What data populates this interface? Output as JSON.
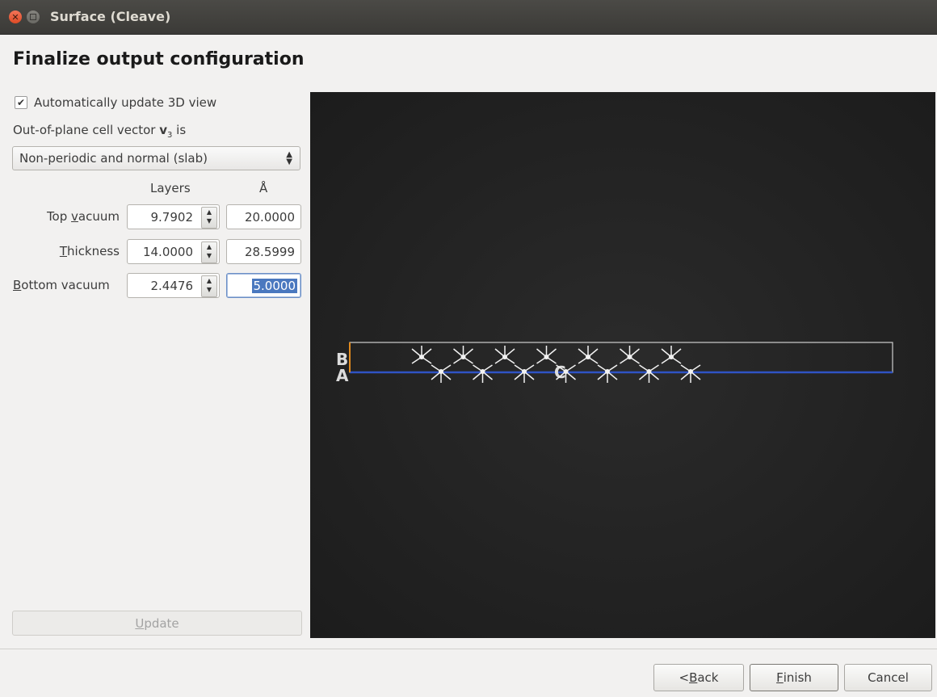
{
  "window": {
    "title": "Surface (Cleave)"
  },
  "page": {
    "title": "Finalize output configuration"
  },
  "auto_update": {
    "label": "Automatically update 3D view",
    "checked": true
  },
  "vector_label": {
    "prefix": "Out-of-plane cell vector ",
    "bold": "v",
    "sub": "3",
    "suffix": " is"
  },
  "vector_combo": {
    "value": "Non-periodic and normal (slab)"
  },
  "columns": {
    "layers": "Layers",
    "angstrom": "Å"
  },
  "rows": [
    {
      "pre": "Top ",
      "mn": "v",
      "post": "acuum",
      "layers": "9.7902",
      "angstrom": "20.0000"
    },
    {
      "pre": "",
      "mn": "T",
      "post": "hickness",
      "layers": "14.0000",
      "angstrom": "28.5999"
    },
    {
      "pre": "",
      "mn": "B",
      "post": "ottom vacuum",
      "layers": "2.4476",
      "angstrom": "5.0000"
    }
  ],
  "viewport": {
    "axis_labels": [
      "B",
      "A",
      "C"
    ]
  },
  "update_button": {
    "mn": "U",
    "rest": "pdate"
  },
  "footer": {
    "back": {
      "pre": "< ",
      "mn": "B",
      "post": "ack"
    },
    "finish": {
      "mn": "F",
      "post": "inish"
    },
    "cancel": "Cancel"
  },
  "colors": {
    "axis_a": "#2f53c4",
    "axis_b": "#e08a1e",
    "cell": "#cfcfcf",
    "atoms": "#f2f2f2"
  }
}
